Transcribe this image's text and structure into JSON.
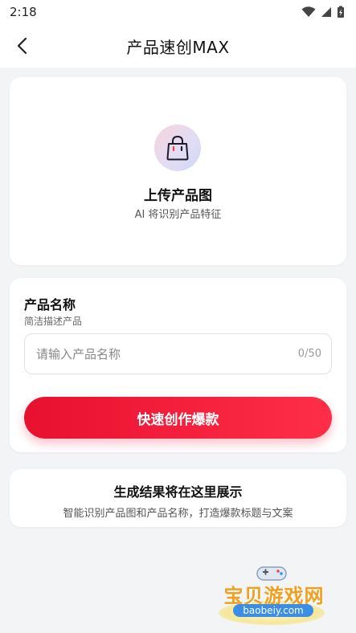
{
  "status_bar": {
    "time": "2:18"
  },
  "nav": {
    "title": "产品速创MAX",
    "back_icon": "chevron-left-icon"
  },
  "upload": {
    "icon": "shopping-bag-icon",
    "title": "上传产品图",
    "subtitle": "AI 将识别产品特征"
  },
  "product_name": {
    "title": "产品名称",
    "subtitle": "简洁描述产品",
    "placeholder": "请输入产品名称",
    "value": "",
    "counter": "0/50"
  },
  "create_button": {
    "label": "快速创作爆款",
    "color_start": "#e8102f",
    "color_end": "#ff2e48"
  },
  "result": {
    "title": "生成结果将在这里展示",
    "subtitle": "智能识别产品图和产品名称，打造爆款标题与文案"
  },
  "watermark": {
    "text": "宝贝游戏网",
    "url": "baobeiy.com"
  }
}
